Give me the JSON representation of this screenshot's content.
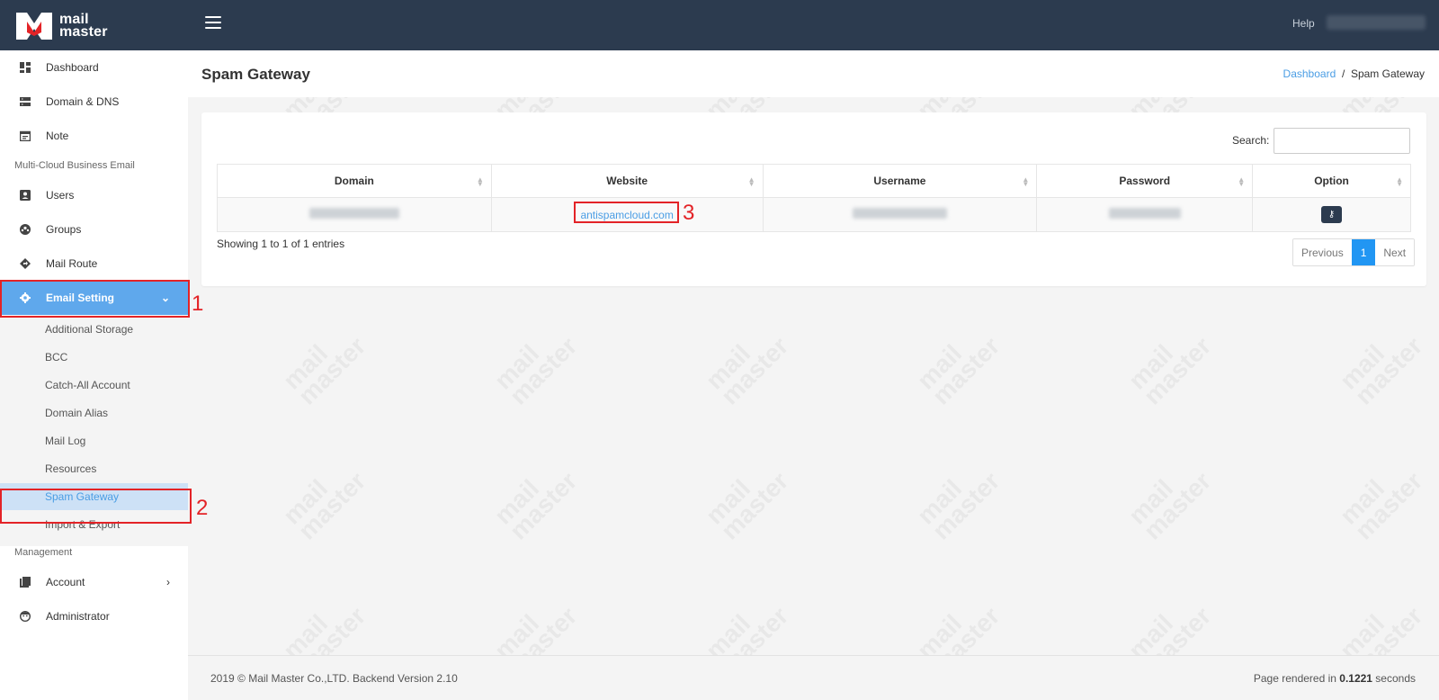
{
  "brand": {
    "line1": "mail",
    "line2": "master"
  },
  "topbar": {
    "help": "Help"
  },
  "sidebar": {
    "items": [
      {
        "label": "Dashboard"
      },
      {
        "label": "Domain & DNS"
      },
      {
        "label": "Note"
      }
    ],
    "section1": "Multi-Cloud Business Email",
    "items2": [
      {
        "label": "Users"
      },
      {
        "label": "Groups"
      },
      {
        "label": "Mail Route"
      },
      {
        "label": "Email Setting"
      }
    ],
    "sub_items": [
      "Additional Storage",
      "BCC",
      "Catch-All Account",
      "Domain Alias",
      "Mail Log",
      "Resources",
      "Spam Gateway",
      "Import & Export"
    ],
    "section2": "Management",
    "items3": [
      {
        "label": "Account"
      },
      {
        "label": "Administrator"
      }
    ]
  },
  "annotations": {
    "n1": "1",
    "n2": "2",
    "n3": "3"
  },
  "page": {
    "title": "Spam Gateway",
    "breadcrumb_home": "Dashboard",
    "breadcrumb_sep": "/",
    "breadcrumb_current": "Spam Gateway"
  },
  "table": {
    "search_label": "Search:",
    "columns": [
      "Domain",
      "Website",
      "Username",
      "Password",
      "Option"
    ],
    "rows": [
      {
        "website": "antispamcloud.com"
      }
    ],
    "showing": "Showing 1 to 1 of 1 entries",
    "pager": {
      "prev": "Previous",
      "current": "1",
      "next": "Next"
    }
  },
  "footer": {
    "left": "2019 © Mail Master Co.,LTD. Backend Version 2.10",
    "right_prefix": "Page rendered in ",
    "right_value": "0.1221",
    "right_suffix": " seconds"
  },
  "colors": {
    "topbar": "#2c3b4f",
    "accent": "#5fa8ec",
    "link": "#4a9de4",
    "annotation": "#e32327"
  }
}
